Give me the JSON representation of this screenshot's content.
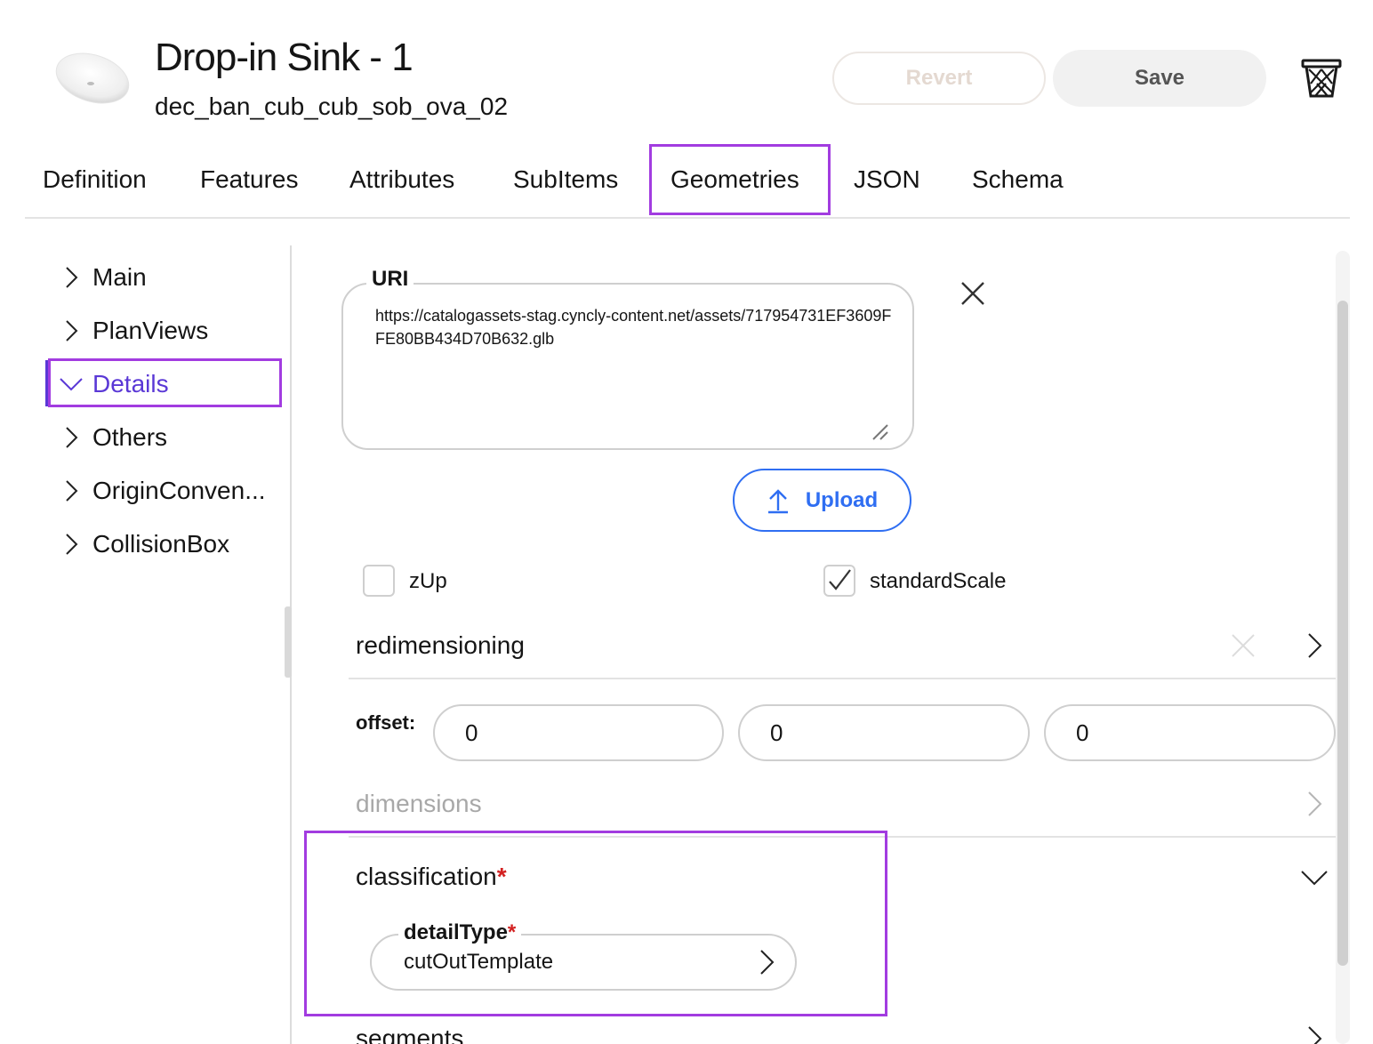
{
  "header": {
    "title": "Drop-in Sink - 1",
    "subtitle": "dec_ban_cub_cub_sob_ova_02",
    "thumbnail_icon": "sink-thumbnail",
    "revert_label": "Revert",
    "save_label": "Save",
    "delete_icon": "trash-icon"
  },
  "tabs": [
    {
      "label": "Definition"
    },
    {
      "label": "Features"
    },
    {
      "label": "Attributes"
    },
    {
      "label": "SubItems"
    },
    {
      "label": "Geometries",
      "active": true
    },
    {
      "label": "JSON"
    },
    {
      "label": "Schema"
    }
  ],
  "sidebar": {
    "items": [
      {
        "label": "Main",
        "expanded": false
      },
      {
        "label": "PlanViews",
        "expanded": false
      },
      {
        "label": "Details",
        "expanded": true
      },
      {
        "label": "Others",
        "expanded": false
      },
      {
        "label": "OriginConven...",
        "expanded": false
      },
      {
        "label": "CollisionBox",
        "expanded": false
      }
    ]
  },
  "geometry": {
    "uri_label": "URI",
    "uri_value": "https://catalogassets-stag.cyncly-content.net/assets/717954731EF3609FFE80BB434D70B632.glb",
    "upload_label": "Upload",
    "zup_label": "zUp",
    "zup_checked": false,
    "standard_scale_label": "standardScale",
    "standard_scale_checked": true
  },
  "sections": {
    "redimensioning": "redimensioning",
    "offset_label": "offset:",
    "offset_values": [
      "0",
      "0",
      "0"
    ],
    "dimensions": "dimensions",
    "classification": "classification",
    "required_mark": "*",
    "detail_type_label": "detailType",
    "detail_type_value": "cutOutTemplate",
    "segments": "segments"
  },
  "colors": {
    "accent_purple": "#a23ce0",
    "active_text": "#5a38d6",
    "upload_blue": "#2f6ef2",
    "required_red": "#d32121"
  }
}
